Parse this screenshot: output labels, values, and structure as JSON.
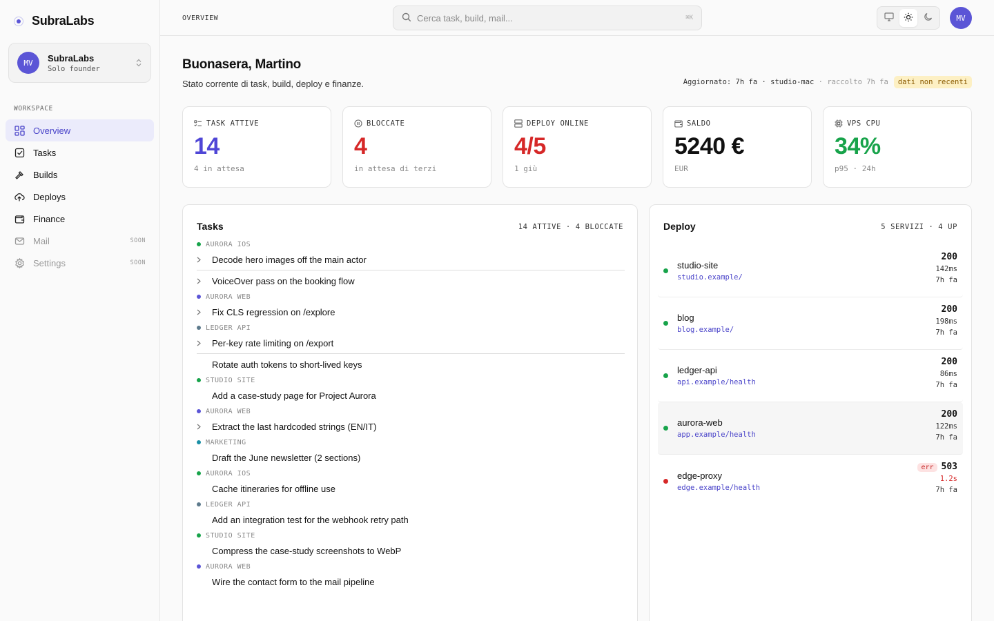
{
  "sidebar": {
    "brand": "SubraLabs",
    "workspace": {
      "initials": "MV",
      "name": "SubraLabs",
      "role": "Solo founder"
    },
    "section_label": "WORKSPACE",
    "items": [
      {
        "label": "Overview",
        "icon": "grid-icon",
        "active": true
      },
      {
        "label": "Tasks",
        "icon": "checkbox-icon"
      },
      {
        "label": "Builds",
        "icon": "hammer-icon"
      },
      {
        "label": "Deploys",
        "icon": "cloud-upload-icon"
      },
      {
        "label": "Finance",
        "icon": "wallet-icon"
      },
      {
        "label": "Mail",
        "icon": "mail-icon",
        "badge": "SOON"
      },
      {
        "label": "Settings",
        "icon": "gear-icon",
        "badge": "SOON"
      }
    ]
  },
  "topbar": {
    "crumb": "OVERVIEW",
    "search_placeholder": "Cerca task, build, mail...",
    "shortcut": "⌘K",
    "avatar": "MV"
  },
  "header": {
    "greeting": "Buonasera, Martino",
    "subtitle": "Stato corrente di task, build, deploy e finanze.",
    "updated": "Aggiornato: 7h fa",
    "host": "studio-mac",
    "collected": "raccolto 7h fa",
    "stale_badge": "dati non recenti"
  },
  "kpis": [
    {
      "label": "TASK ATTIVE",
      "value": "14",
      "sub": "4 in attesa",
      "color": "#4f46d6"
    },
    {
      "label": "BLOCCATE",
      "value": "4",
      "sub": "in attesa di terzi",
      "color": "#d62828"
    },
    {
      "label": "DEPLOY ONLINE",
      "value": "4/5",
      "sub": "1 giù",
      "color": "#d62828"
    },
    {
      "label": "SALDO",
      "value": "5240 €",
      "sub": "EUR",
      "color": "#111111"
    },
    {
      "label": "VPS CPU",
      "value": "34%",
      "sub": "p95 · 24h",
      "color": "#17a34a"
    }
  ],
  "tasks": {
    "title": "Tasks",
    "meta": "14 ATTIVE · 4 BLOCCATE",
    "groups": {
      "g1": "AURORA IOS",
      "g2": "AURORA WEB",
      "g3": "LEDGER API",
      "g4": "STUDIO SITE",
      "g5": "AURORA WEB",
      "g6": "MARKETING",
      "g7": "AURORA IOS",
      "g8": "LEDGER API",
      "g9": "STUDIO SITE",
      "g10": "AURORA WEB"
    },
    "items": {
      "t1": "Decode hero images off the main actor",
      "t2": "VoiceOver pass on the booking flow",
      "t3": "Fix CLS regression on /explore",
      "t4": "Per-key rate limiting on /export",
      "t5": "Rotate auth tokens to short-lived keys",
      "t6": "Add a case-study page for Project Aurora",
      "t7": "Extract the last hardcoded strings (EN/IT)",
      "t8": "Draft the June newsletter (2 sections)",
      "t9": "Cache itineraries for offline use",
      "t10": "Add an integration test for the webhook retry path",
      "t11": "Compress the case-study screenshots to WebP",
      "t12": "Wire the contact form to the mail pipeline"
    }
  },
  "deploy": {
    "title": "Deploy",
    "meta": "5 SERVIZI · 4 UP",
    "services": [
      {
        "name": "studio-site",
        "url": "studio.example/",
        "code": "200",
        "latency": "142ms",
        "ago": "7h fa"
      },
      {
        "name": "blog",
        "url": "blog.example/",
        "code": "200",
        "latency": "198ms",
        "ago": "7h fa"
      },
      {
        "name": "ledger-api",
        "url": "api.example/health",
        "code": "200",
        "latency": "86ms",
        "ago": "7h fa"
      },
      {
        "name": "aurora-web",
        "url": "app.example/health",
        "code": "200",
        "latency": "122ms",
        "ago": "7h fa"
      },
      {
        "name": "edge-proxy",
        "url": "edge.example/health",
        "code": "503",
        "latency": "1.2s",
        "ago": "7h fa",
        "badge": "err"
      }
    ]
  }
}
